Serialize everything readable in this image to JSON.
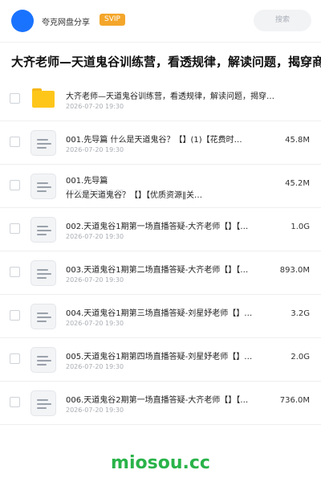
{
  "header": {
    "user_name": "夸克网盘分享",
    "badge": "SVIP",
    "search_placeholder": "搜索"
  },
  "title": "大齐老师—天道鬼谷训练营，看透规律，解读问题，揭穿商",
  "items": [
    {
      "type": "folder",
      "name": "大齐老师—天道鬼谷训练营，看透规律，解读问题，揭穿…",
      "date": "2026-07-20 19:30",
      "size": ""
    },
    {
      "type": "file",
      "name": "001.先导篇 什么是天道鬼谷？【】(1)【花费时…",
      "date": "2026-07-20 19:30",
      "size": "45.8M"
    },
    {
      "type": "file",
      "name": "001.先导篇",
      "name2": "什么是天道鬼谷？【】【优质资源‖关…",
      "date": "2026-07-20 19:30",
      "size": "45.2M"
    },
    {
      "type": "file",
      "name": "002.天道鬼谷1期第一场直播答疑-大齐老师【】【…",
      "date": "2026-07-20 19:30",
      "size": "1.0G"
    },
    {
      "type": "file",
      "name": "003.天道鬼谷1期第二场直播答疑-大齐老师【】【…",
      "date": "2026-07-20 19:30",
      "size": "893.0M"
    },
    {
      "type": "file",
      "name": "004.天道鬼谷1期第三场直播答疑-刘星妤老师【】…",
      "date": "2026-07-20 19:30",
      "size": "3.2G"
    },
    {
      "type": "file",
      "name": "005.天道鬼谷1期第四场直播答疑-刘星妤老师【】…",
      "date": "2026-07-20 19:30",
      "size": "2.0G"
    },
    {
      "type": "file",
      "name": "006.天道鬼谷2期第一场直播答疑-大齐老师【】【…",
      "date": "2026-07-20 19:30",
      "size": "736.0M"
    }
  ],
  "watermark": "miosou.cc",
  "colors": {
    "accent": "#1a73ff",
    "svip": "#f4a62a",
    "folder": "#ffc61a",
    "watermark": "#2ab34a"
  }
}
